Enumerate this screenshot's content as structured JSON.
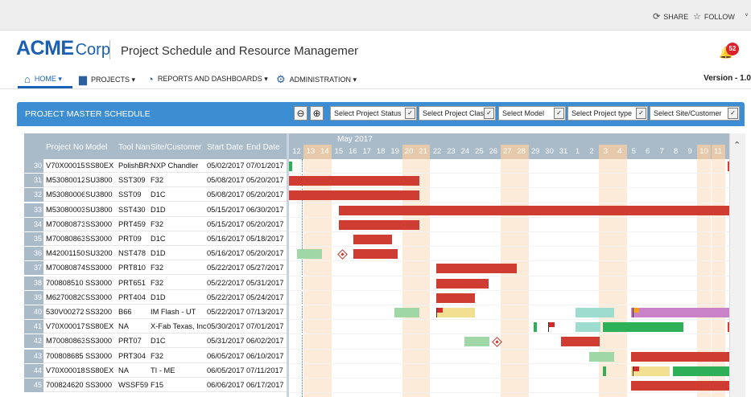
{
  "top_links": {
    "share": "SHARE",
    "follow": "FOLLOW",
    "trailing": "ᵛ"
  },
  "brand": {
    "strong": "ACME",
    "light": "Corp"
  },
  "app_title": "Project Schedule and Resource Management",
  "notifications": {
    "count": "52"
  },
  "nav": {
    "home": "HOME ▾",
    "projects": "PROJECTS ▾",
    "reports": "REPORTS AND DASHBOARDS ▾",
    "admin": "ADMINISTRATION ▾",
    "version": "Version - 1.0"
  },
  "panel": {
    "title": "PROJECT MASTER SCHEDULE",
    "filters": {
      "status": "Select Project Status",
      "class": "Select Project Clas",
      "model": "Select Model",
      "type": "Select Project type",
      "site": "Select Site/Customer"
    }
  },
  "columns": {
    "project_no": "Project No",
    "model": "Model",
    "tool": "Tool Nan",
    "site": "Site/Customer",
    "start": "Start Date",
    "end": "End Date"
  },
  "rows": [
    {
      "n": "30",
      "project": "V70X00015",
      "model": "SS80EX",
      "tool": "PolishBR:",
      "site": "NXP Chandler",
      "start": "05/02/2017",
      "end": "07/01/2017"
    },
    {
      "n": "31",
      "project": "M53080012",
      "model": "SU3800",
      "tool": "SST309",
      "site": "F32",
      "start": "05/08/2017",
      "end": "05/20/2017"
    },
    {
      "n": "32",
      "project": "M53080006",
      "model": "SU3800",
      "tool": "SST09",
      "site": "D1C",
      "start": "05/08/2017",
      "end": "05/20/2017"
    },
    {
      "n": "33",
      "project": "M53080003",
      "model": "SU3800",
      "tool": "SST430",
      "site": "D1D",
      "start": "05/15/2017",
      "end": "06/30/2017"
    },
    {
      "n": "34",
      "project": "M70080873",
      "model": "SS3000",
      "tool": "PRT459",
      "site": "F32",
      "start": "05/15/2017",
      "end": "05/20/2017"
    },
    {
      "n": "35",
      "project": "M70080863",
      "model": "SS3000",
      "tool": "PRT09",
      "site": "D1C",
      "start": "05/16/2017",
      "end": "05/18/2017"
    },
    {
      "n": "36",
      "project": "M42001150",
      "model": "SU3200",
      "tool": "NST478",
      "site": "D1D",
      "start": "05/16/2017",
      "end": "05/20/2017"
    },
    {
      "n": "37",
      "project": "M70080874",
      "model": "SS3000",
      "tool": "PRT810",
      "site": "F32",
      "start": "05/22/2017",
      "end": "05/27/2017"
    },
    {
      "n": "38",
      "project": "700808510",
      "model": "SS3000",
      "tool": "PRT651",
      "site": "F32",
      "start": "05/22/2017",
      "end": "05/31/2017"
    },
    {
      "n": "39",
      "project": "M62700820",
      "model": "SS3000",
      "tool": "PRT404",
      "site": "D1D",
      "start": "05/22/2017",
      "end": "05/24/2017"
    },
    {
      "n": "40",
      "project": "530V00272",
      "model": "SS3200",
      "tool": "B66",
      "site": "IM Flash - UT",
      "start": "05/22/2017",
      "end": "07/13/2017"
    },
    {
      "n": "41",
      "project": "V70X00017",
      "model": "SS80EX",
      "tool": "NA",
      "site": "X-Fab Texas, Inc",
      "start": "05/30/2017",
      "end": "07/01/2017"
    },
    {
      "n": "42",
      "project": "M70080863",
      "model": "SS3000",
      "tool": "PRT07",
      "site": "D1C",
      "start": "05/31/2017",
      "end": "06/02/2017"
    },
    {
      "n": "43",
      "project": "700808685",
      "model": "SS3000",
      "tool": "PRT304",
      "site": "F32",
      "start": "06/05/2017",
      "end": "06/10/2017"
    },
    {
      "n": "44",
      "project": "V70X00018",
      "model": "SS80EX",
      "tool": "NA",
      "site": "TI - ME",
      "start": "06/05/2017",
      "end": "07/11/2017"
    },
    {
      "n": "45",
      "project": "700824620",
      "model": "SS3000",
      "tool": "WSSF59",
      "site": "F15",
      "start": "06/06/2017",
      "end": "06/17/2017"
    }
  ],
  "gantt": {
    "month": "May 2017",
    "days": [
      "12",
      "13",
      "14",
      "15",
      "16",
      "17",
      "18",
      "19",
      "20",
      "21",
      "22",
      "23",
      "24",
      "25",
      "26",
      "27",
      "28",
      "29",
      "30",
      "31",
      "1",
      "2",
      "3",
      "4",
      "5",
      "6",
      "7",
      "8",
      "9",
      "10",
      "11"
    ]
  },
  "colors": {
    "red": "#cf3d32",
    "green": "#2eb058",
    "light_green": "#9fd7a6",
    "teal": "#9fdcd0",
    "yellow": "#f2df8f",
    "purple": "#c982c8",
    "flag_red": "#d22a2a",
    "flag_orange": "#f0a020"
  }
}
